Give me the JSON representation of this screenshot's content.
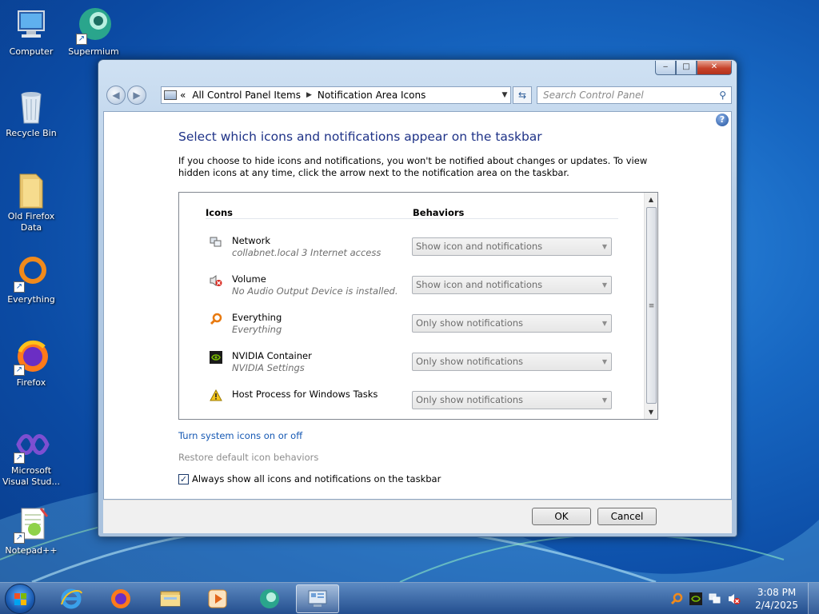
{
  "desktop": {
    "icons": [
      {
        "label": "Computer",
        "icon": "computer-icon"
      },
      {
        "label": "Supermium",
        "icon": "supermium-icon"
      },
      {
        "label": "Recycle Bin",
        "icon": "recycle-bin-icon"
      },
      {
        "label": "Old Firefox Data",
        "icon": "folder-icon"
      },
      {
        "label": "Everything",
        "icon": "everything-icon"
      },
      {
        "label": "Firefox",
        "icon": "firefox-icon"
      },
      {
        "label": "Microsoft Visual Stud...",
        "icon": "visual-studio-icon"
      },
      {
        "label": "Notepad++",
        "icon": "notepadpp-icon"
      }
    ]
  },
  "window": {
    "caption_buttons": {
      "minimize": "‒",
      "maximize": "□",
      "close": "✕"
    },
    "breadcrumb": [
      "All Control Panel Items",
      "Notification Area Icons"
    ],
    "breadcrumb_prefix": "«",
    "search_placeholder": "Search Control Panel",
    "help": "?",
    "title": "Select which icons and notifications appear on the taskbar",
    "description": "If you choose to hide icons and notifications, you won't be notified about changes or updates. To view hidden icons at any time, click the arrow next to the notification area on the taskbar.",
    "columns": {
      "icons": "Icons",
      "behaviors": "Behaviors"
    },
    "rows": [
      {
        "name": "Network",
        "sub": "collabnet.local  3 Internet access",
        "behavior": "Show icon and notifications",
        "icon": "network-icon"
      },
      {
        "name": "Volume",
        "sub": "No Audio Output Device is installed.",
        "behavior": "Show icon and notifications",
        "icon": "volume-muted-icon"
      },
      {
        "name": "Everything",
        "sub": "Everything",
        "behavior": "Only show notifications",
        "icon": "everything-search-icon"
      },
      {
        "name": "NVIDIA Container",
        "sub": "NVIDIA Settings",
        "behavior": "Only show notifications",
        "icon": "nvidia-icon"
      },
      {
        "name": "Host Process for Windows Tasks",
        "sub": "",
        "behavior": "Only show notifications",
        "icon": "warning-icon"
      }
    ],
    "link_system_icons": "Turn system icons on or off",
    "link_restore": "Restore default icon behaviors",
    "always_show": {
      "label": "Always show all icons and notifications on the taskbar",
      "checked": true
    },
    "ok": "OK",
    "cancel": "Cancel"
  },
  "taskbar": {
    "pinned": [
      "internet-explorer-icon",
      "firefox-icon",
      "file-explorer-icon",
      "media-player-icon",
      "supermium-icon",
      "control-panel-icon"
    ],
    "clock_time": "3:08 PM",
    "clock_date": "2/4/2025"
  },
  "colors": {
    "title": "#1e3287",
    "link": "#1558b3",
    "disabled": "#8d8d8d"
  }
}
